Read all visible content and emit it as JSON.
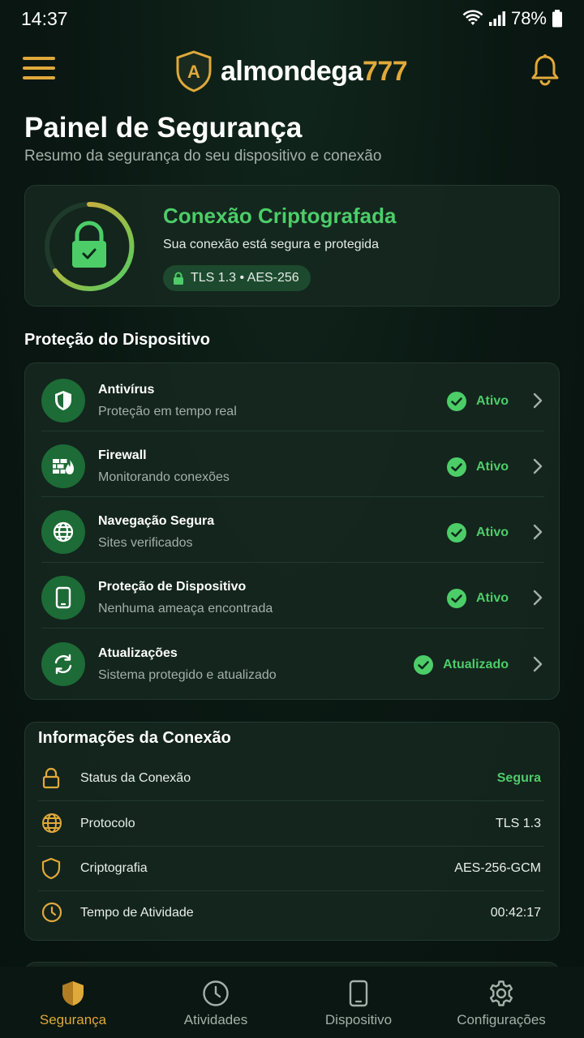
{
  "status_bar": {
    "time": "14:37",
    "battery": "78%"
  },
  "header": {
    "brand_part1": "almondega",
    "brand_part2": "777",
    "logo_letter": "A"
  },
  "page": {
    "title": "Painel de Segurança",
    "subtitle": "Resumo da segurança do seu dispositivo e conexão"
  },
  "connection_card": {
    "title": "Conexão Criptografada",
    "subtitle": "Sua conexão está segura e protegida",
    "chip": "TLS 1.3 • AES-256"
  },
  "device_protection": {
    "title": "Proteção do Dispositivo",
    "items": [
      {
        "title": "Antivírus",
        "subtitle": "Proteção em tempo real",
        "status": "Ativo",
        "icon": "shield-icon"
      },
      {
        "title": "Firewall",
        "subtitle": "Monitorando conexões",
        "status": "Ativo",
        "icon": "firewall-icon"
      },
      {
        "title": "Navegação Segura",
        "subtitle": "Sites verificados",
        "status": "Ativo",
        "icon": "globe-icon"
      },
      {
        "title": "Proteção de Dispositivo",
        "subtitle": "Nenhuma ameaça encontrada",
        "status": "Ativo",
        "icon": "phone-icon"
      },
      {
        "title": "Atualizações",
        "subtitle": "Sistema protegido e atualizado",
        "status": "Atualizado",
        "icon": "sync-icon"
      }
    ]
  },
  "connection_info": {
    "title": "Informações da Conexão",
    "rows": [
      {
        "label": "Status da Conexão",
        "value": "Segura",
        "icon": "lock-icon"
      },
      {
        "label": "Protocolo",
        "value": "TLS 1.3",
        "icon": "globe-icon"
      },
      {
        "label": "Criptografia",
        "value": "AES-256-GCM",
        "icon": "shield-icon"
      },
      {
        "label": "Tempo de Atividade",
        "value": "00:42:17",
        "icon": "clock-icon"
      }
    ]
  },
  "bottom_nav": {
    "items": [
      {
        "label": "Segurança",
        "icon": "shield-icon",
        "active": true
      },
      {
        "label": "Atividades",
        "icon": "clock-icon",
        "active": false
      },
      {
        "label": "Dispositivo",
        "icon": "phone-icon",
        "active": false
      },
      {
        "label": "Configurações",
        "icon": "gear-icon",
        "active": false
      }
    ]
  },
  "colors": {
    "accent": "#e0a93b",
    "success": "#4ccd68",
    "background": "#0a1712",
    "card": "#162820",
    "icon_circle": "#1d6b36"
  }
}
